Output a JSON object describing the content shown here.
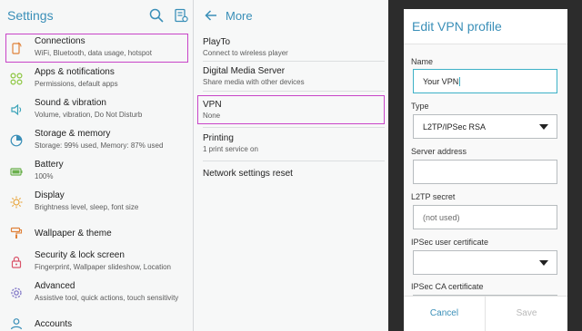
{
  "settings": {
    "title": "Settings",
    "items": [
      {
        "label": "Connections",
        "sub": "WiFi, Bluetooth, data usage, hotspot",
        "icon": "connections-icon"
      },
      {
        "label": "Apps & notifications",
        "sub": "Permissions, default apps",
        "icon": "apps-icon"
      },
      {
        "label": "Sound & vibration",
        "sub": "Volume, vibration, Do Not Disturb",
        "icon": "sound-icon"
      },
      {
        "label": "Storage & memory",
        "sub": "Storage: 99% used, Memory: 87% used",
        "icon": "storage-icon"
      },
      {
        "label": "Battery",
        "sub": "100%",
        "icon": "battery-icon"
      },
      {
        "label": "Display",
        "sub": "Brightness level, sleep, font size",
        "icon": "display-icon"
      },
      {
        "label": "Wallpaper & theme",
        "sub": "",
        "icon": "wallpaper-icon"
      },
      {
        "label": "Security & lock screen",
        "sub": "Fingerprint, Wallpaper slideshow, Location",
        "icon": "security-icon"
      },
      {
        "label": "Advanced",
        "sub": "Assistive tool, quick actions, touch sensitivity",
        "icon": "advanced-icon"
      },
      {
        "label": "Accounts",
        "sub": "",
        "icon": "accounts-icon"
      }
    ]
  },
  "more": {
    "title": "More",
    "items": [
      {
        "label": "PlayTo",
        "sub": "Connect to wireless player"
      },
      {
        "label": "Digital Media Server",
        "sub": "Share media with other devices"
      },
      {
        "label": "VPN",
        "sub": "None"
      },
      {
        "label": "Printing",
        "sub": "1 print service on"
      },
      {
        "label": "Network settings reset",
        "sub": ""
      }
    ]
  },
  "dialog": {
    "title": "Edit VPN profile",
    "name_label": "Name",
    "name_value": "Your VPN",
    "type_label": "Type",
    "type_value": "L2TP/IPSec RSA",
    "server_label": "Server address",
    "server_value": "",
    "secret_label": "L2TP secret",
    "secret_placeholder": "(not used)",
    "user_cert_label": "IPSec user certificate",
    "user_cert_value": "",
    "ca_cert_label": "IPSec CA certificate",
    "cancel_label": "Cancel",
    "save_label": "Save"
  },
  "colors": {
    "accent": "#3a8fb8",
    "selection_outline": "#c844c8",
    "focus": "#3db1c7"
  }
}
